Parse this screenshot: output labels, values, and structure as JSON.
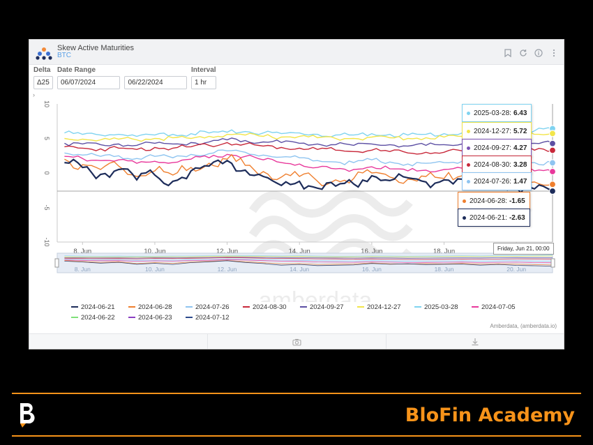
{
  "header": {
    "title": "Skew Active Maturities",
    "subtitle": "BTC"
  },
  "controls": {
    "delta": {
      "label": "Delta",
      "value": "Δ25"
    },
    "date_range": {
      "label": "Date Range",
      "start": "06/07/2024",
      "end": "06/22/2024"
    },
    "interval": {
      "label": "Interval",
      "value": "1 hr"
    }
  },
  "watermark": "amberdata",
  "credit": "Amberdata, (amberdata.io)",
  "x_tooltip": "Friday, Jun 21, 00:00",
  "brand": {
    "name": "BloFin Academy",
    "accent": "#f7931a"
  },
  "tooltips": [
    {
      "label": "2025-03-28:",
      "value": "6.43",
      "color": "#7fd3f0"
    },
    {
      "label": "2024-12-27:",
      "value": "5.72",
      "color": "#f2e54a"
    },
    {
      "label": "2024-09-27:",
      "value": "4.27",
      "color": "#7a52b3"
    },
    {
      "label": "2024-08-30:",
      "value": "3.28",
      "color": "#c8283a"
    },
    {
      "label": "2024-07-26:",
      "value": "1.47",
      "color": "#8ec4f0"
    },
    {
      "label": "2024-06-28:",
      "value": "-1.65",
      "color": "#ef7f2e"
    },
    {
      "label": "2024-06-21:",
      "value": "-2.63",
      "color": "#1d2c5a"
    }
  ],
  "legend": [
    {
      "label": "2024-06-21",
      "color": "#1d2c5a"
    },
    {
      "label": "2024-06-28",
      "color": "#ef7f2e"
    },
    {
      "label": "2024-07-26",
      "color": "#8ec4f0"
    },
    {
      "label": "2024-08-30",
      "color": "#c8283a"
    },
    {
      "label": "2024-09-27",
      "color": "#5c4fa3"
    },
    {
      "label": "2024-12-27",
      "color": "#f2e54a"
    },
    {
      "label": "2025-03-28",
      "color": "#7fd3f0"
    },
    {
      "label": "2024-07-05",
      "color": "#e8389b"
    },
    {
      "label": "2024-06-22",
      "color": "#7fe07a"
    },
    {
      "label": "2024-06-23",
      "color": "#8a3fc2"
    },
    {
      "label": "2024-07-12",
      "color": "#2d4a8c"
    }
  ],
  "chart_data": {
    "type": "line",
    "ylim": [
      -10,
      10
    ],
    "yticks": [
      10,
      5,
      0,
      -5,
      -10
    ],
    "xlim": [
      7.3,
      21.0
    ],
    "x_unit": "day of June 2024",
    "xticks": [
      {
        "x": 8,
        "label": "8. Jun"
      },
      {
        "x": 10,
        "label": "10. Jun"
      },
      {
        "x": 12,
        "label": "12. Jun"
      },
      {
        "x": 14,
        "label": "14. Jun"
      },
      {
        "x": 16,
        "label": "16. Jun"
      },
      {
        "x": 18,
        "label": "18. Jun"
      },
      {
        "x": 20,
        "label": "20. Jun"
      }
    ],
    "reference_line": -2.63,
    "x": [
      7.5,
      8.0,
      8.5,
      9.0,
      9.5,
      10.0,
      10.5,
      11.0,
      11.5,
      12.0,
      12.5,
      13.0,
      13.5,
      14.0,
      14.5,
      15.0,
      15.5,
      16.0,
      16.5,
      17.0,
      17.5,
      18.0,
      18.5,
      19.0,
      19.5,
      20.0,
      20.5,
      21.0
    ],
    "series": [
      {
        "name": "2025-03-28",
        "color": "#7fd3f0",
        "values": [
          5.8,
          5.6,
          5.5,
          5.6,
          5.3,
          5.5,
          5.6,
          5.7,
          5.8,
          5.9,
          6.0,
          5.8,
          5.7,
          5.8,
          5.6,
          5.5,
          5.5,
          5.7,
          5.6,
          5.5,
          5.6,
          5.7,
          5.8,
          5.7,
          5.9,
          6.0,
          6.1,
          6.43
        ]
      },
      {
        "name": "2024-12-27",
        "color": "#f2e54a",
        "values": [
          5.0,
          4.9,
          4.8,
          4.9,
          4.8,
          5.0,
          5.1,
          5.0,
          5.3,
          5.6,
          5.5,
          5.3,
          5.2,
          5.3,
          5.1,
          5.0,
          5.0,
          5.2,
          5.1,
          5.0,
          5.1,
          5.2,
          5.3,
          5.2,
          5.4,
          5.5,
          5.6,
          5.72
        ]
      },
      {
        "name": "2024-09-27",
        "color": "#5c4fa3",
        "values": [
          4.3,
          4.2,
          4.1,
          4.2,
          4.0,
          4.3,
          4.2,
          4.4,
          4.5,
          4.8,
          4.7,
          4.5,
          4.4,
          4.3,
          4.2,
          4.1,
          4.0,
          4.2,
          4.1,
          3.9,
          4.0,
          4.1,
          4.2,
          4.1,
          4.3,
          4.4,
          4.3,
          4.27
        ]
      },
      {
        "name": "2024-08-30",
        "color": "#c8283a",
        "values": [
          3.8,
          3.6,
          3.5,
          3.6,
          3.4,
          3.7,
          3.6,
          3.8,
          4.0,
          4.4,
          4.2,
          3.9,
          3.7,
          3.6,
          3.4,
          3.3,
          3.1,
          3.3,
          3.1,
          2.9,
          3.0,
          3.0,
          3.2,
          3.1,
          3.2,
          3.4,
          3.3,
          3.28
        ]
      },
      {
        "name": "2024-07-26",
        "color": "#8ec4f0",
        "values": [
          2.9,
          2.6,
          2.4,
          2.5,
          2.1,
          2.4,
          2.2,
          2.7,
          2.8,
          3.2,
          3.0,
          2.6,
          2.3,
          2.2,
          1.8,
          1.6,
          1.5,
          1.9,
          1.6,
          1.3,
          1.4,
          1.5,
          1.7,
          1.4,
          1.6,
          1.8,
          1.5,
          1.47
        ]
      },
      {
        "name": "2024-07-05",
        "color": "#e8389b",
        "values": [
          2.4,
          2.1,
          1.8,
          1.9,
          1.4,
          1.7,
          1.5,
          2.0,
          2.2,
          2.7,
          2.4,
          1.9,
          1.5,
          1.3,
          0.8,
          0.6,
          0.5,
          0.9,
          0.6,
          0.3,
          0.4,
          0.5,
          0.7,
          0.3,
          0.5,
          0.6,
          0.3,
          0.2
        ]
      },
      {
        "name": "2024-06-28",
        "color": "#ef7f2e",
        "values": [
          2.0,
          1.2,
          0.5,
          1.0,
          -0.5,
          0.3,
          -0.3,
          0.8,
          1.4,
          2.0,
          1.1,
          0.2,
          -0.6,
          -0.5,
          -1.2,
          -1.0,
          -0.8,
          0.0,
          -0.6,
          -0.9,
          -0.5,
          -0.8,
          -0.4,
          -0.9,
          -0.6,
          -1.0,
          -1.3,
          -1.65
        ]
      },
      {
        "name": "2024-06-21",
        "color": "#1d2c5a",
        "values": [
          1.5,
          0.8,
          -0.2,
          0.5,
          -1.0,
          -0.3,
          -1.2,
          0.3,
          1.0,
          1.8,
          0.4,
          -0.5,
          -1.8,
          -1.2,
          -2.2,
          -1.9,
          -1.6,
          -0.4,
          -1.1,
          -0.7,
          -1.3,
          -1.0,
          -0.9,
          -1.8,
          -1.2,
          -2.0,
          -2.3,
          -2.63
        ]
      }
    ]
  }
}
